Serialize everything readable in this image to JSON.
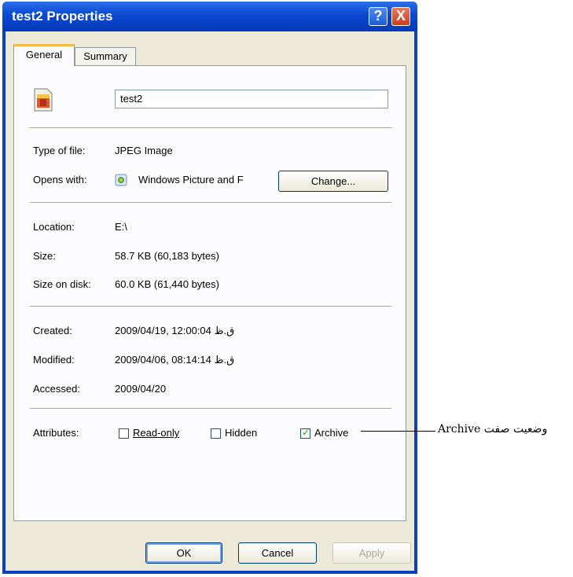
{
  "window": {
    "title": "test2 Properties",
    "help_symbol": "?",
    "close_symbol": "X"
  },
  "tabs": [
    {
      "label": "General"
    },
    {
      "label": "Summary"
    }
  ],
  "file": {
    "name": "test2",
    "icon": "jpeg-file-icon"
  },
  "details": {
    "type_label": "Type of file:",
    "type_value": "JPEG Image",
    "opens_label": "Opens with:",
    "opens_value": "Windows Picture and F",
    "change_label": "Change...",
    "location_label": "Location:",
    "location_value": "E:\\",
    "size_label": "Size:",
    "size_value": "58.7 KB (60,183 bytes)",
    "sizeondisk_label": "Size on disk:",
    "sizeondisk_value": "60.0 KB (61,440 bytes)",
    "created_label": "Created:",
    "created_value": "2009/04/19, 12:00:04 ق.ظ",
    "modified_label": "Modified:",
    "modified_value": "2009/04/06, 08:14:14 ق.ظ",
    "accessed_label": "Accessed:",
    "accessed_value": "2009/04/20"
  },
  "attributes": {
    "label": "Attributes:",
    "readonly": {
      "label": "Read-only",
      "checked": false
    },
    "hidden": {
      "label": "Hidden",
      "checked": false
    },
    "archive": {
      "label": "Archive",
      "checked": true
    }
  },
  "buttons": {
    "ok": "OK",
    "cancel": "Cancel",
    "apply": "Apply"
  },
  "annotation": "وضعیت صفت Archive",
  "colors": {
    "titlebar": "#0a48d1",
    "client": "#ece9d8",
    "tab_accent": "#f7b84a"
  }
}
